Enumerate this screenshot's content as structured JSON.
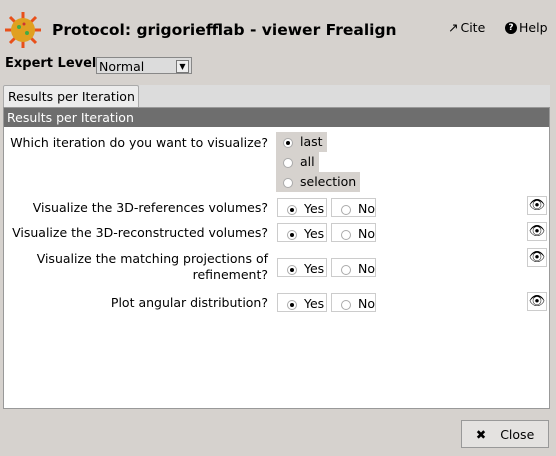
{
  "header": {
    "title": "Protocol: grigoriefflab - viewer Frealign",
    "cite_label": "Cite",
    "help_label": "Help"
  },
  "expert_level": {
    "label": "Expert Level",
    "value": "Normal"
  },
  "tabs": [
    {
      "label": "Results per Iteration"
    }
  ],
  "section": {
    "title": "Results per Iteration"
  },
  "iteration": {
    "question": "Which iteration do you want to visualize?",
    "options": [
      "last",
      "all",
      "selection"
    ],
    "selected": "last"
  },
  "params": [
    {
      "question": "Visualize the 3D-references volumes?",
      "yes": "Yes",
      "no": "No",
      "selected": "Yes"
    },
    {
      "question": "Visualize the 3D-reconstructed volumes?",
      "yes": "Yes",
      "no": "No",
      "selected": "Yes"
    },
    {
      "question": "Visualize the matching projections of refinement?",
      "yes": "Yes",
      "no": "No",
      "selected": "Yes"
    },
    {
      "question": "Plot angular distribution?",
      "yes": "Yes",
      "no": "No",
      "selected": "Yes"
    }
  ],
  "footer": {
    "close_label": "Close"
  }
}
